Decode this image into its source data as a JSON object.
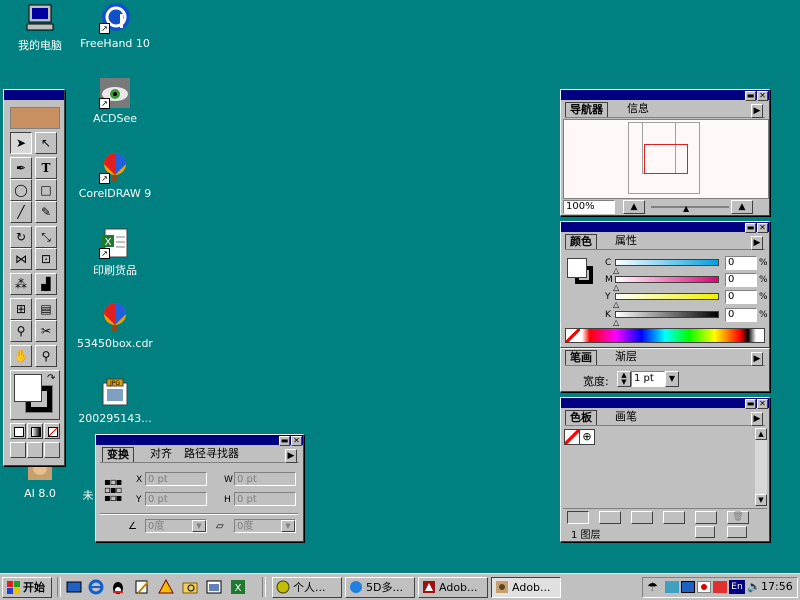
{
  "desktop": {
    "icons": [
      {
        "label": "我的电脑",
        "icon": "my-computer-icon"
      },
      {
        "label": "FreeHand 10",
        "icon": "freehand-icon"
      },
      {
        "label": "ACDSee",
        "icon": "acdsee-icon"
      },
      {
        "label": "CorelDRAW 9",
        "icon": "coreldraw-icon"
      },
      {
        "label": "印刷货品",
        "icon": "excel-file-icon"
      },
      {
        "label": "53450box.cdr",
        "icon": "cdr-file-icon"
      },
      {
        "label": "200295143...",
        "icon": "jpg-file-icon"
      },
      {
        "label": "AI 8.0",
        "icon": "illustrator-icon"
      },
      {
        "label": "未",
        "icon": "unknown-icon"
      }
    ]
  },
  "navigator": {
    "tabs": [
      "导航器",
      "信息"
    ],
    "zoom": "100%"
  },
  "color": {
    "tabs": [
      "颜色",
      "属性"
    ],
    "channels": [
      {
        "label": "C",
        "value": "0",
        "unit": "%"
      },
      {
        "label": "M",
        "value": "0",
        "unit": "%"
      },
      {
        "label": "Y",
        "value": "0",
        "unit": "%"
      },
      {
        "label": "K",
        "value": "0",
        "unit": "%"
      }
    ]
  },
  "stroke": {
    "tabs": [
      "笔画",
      "渐层"
    ],
    "width_label": "宽度:",
    "width_value": "1 pt"
  },
  "swatches": {
    "tabs": [
      "色板",
      "画笔"
    ],
    "layers_label": "1 图层"
  },
  "transform": {
    "tabs": [
      "变换",
      "对齐",
      "路径寻找器"
    ],
    "x_label": "X",
    "x_value": "0 pt",
    "y_label": "Y",
    "y_value": "0 pt",
    "w_label": "W",
    "w_value": "0 pt",
    "h_label": "H",
    "h_value": "0 pt",
    "rotate_value": "0度",
    "shear_value": "0度"
  },
  "taskbar": {
    "start_label": "开始",
    "tasks": [
      "个人...",
      "5D多...",
      "Adob...",
      "Adob..."
    ],
    "clock": "17:56",
    "ime": "En"
  },
  "colors": {
    "desktop": "#008080",
    "titlebar": "#000080"
  }
}
